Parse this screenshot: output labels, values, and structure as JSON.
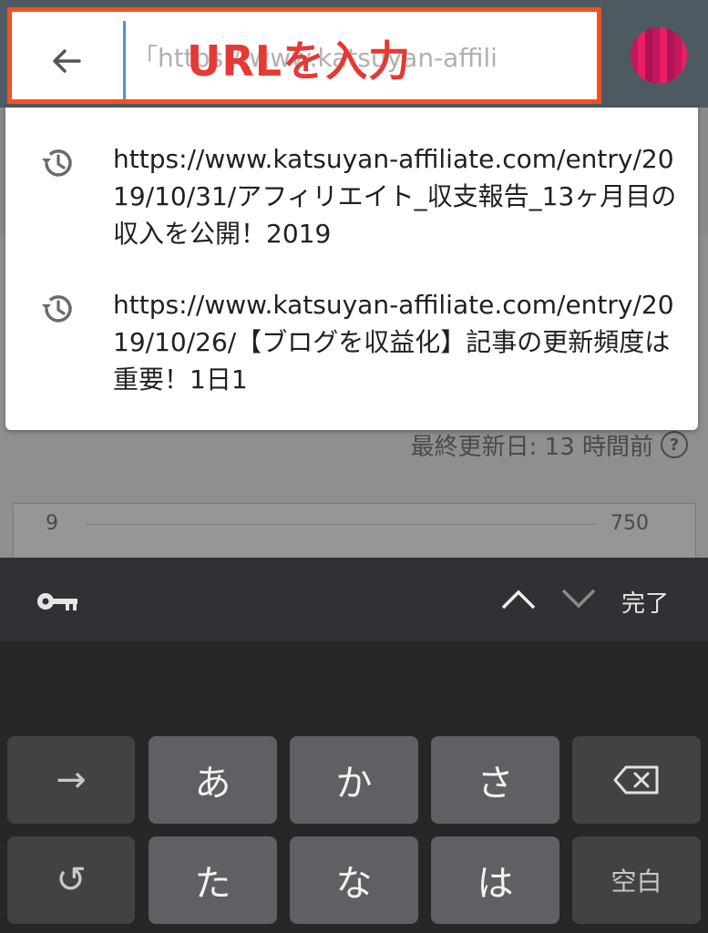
{
  "url_bar": {
    "input_text": "「https://www.katsuyan-affili",
    "overlay_label": "URLを入力"
  },
  "suggestions": [
    {
      "icon": "history-icon",
      "text": "https://www.katsuyan-affiliate.com/entry/2019/10/31/アフィリエイト_収支報告_13ヶ月目の収入を公開！2019"
    },
    {
      "icon": "history-icon",
      "text": "https://www.katsuyan-affiliate.com/entry/2019/10/26/【ブログを収益化】記事の更新頻度は重要！1日1"
    }
  ],
  "background_page": {
    "last_updated": "最終更新日: 13 時間前",
    "help_icon": "?",
    "chart_left_value": "9",
    "chart_right_value": "750"
  },
  "keyboard": {
    "toolbar": {
      "done_label": "完了"
    },
    "row1": [
      "→",
      "あ",
      "か",
      "さ",
      "⌫"
    ],
    "row2": [
      "↺",
      "た",
      "な",
      "は",
      "空白"
    ]
  },
  "colors": {
    "highlight_border": "#f4511e",
    "overlay_label": "#e53935",
    "cursor": "#4a90e2",
    "keyboard_bg": "#262729"
  }
}
